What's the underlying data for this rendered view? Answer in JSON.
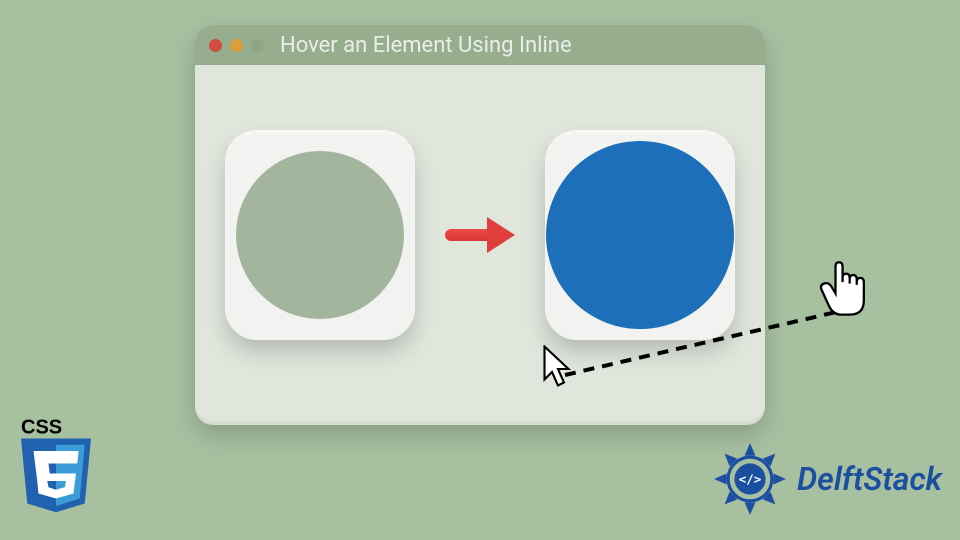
{
  "window": {
    "title": "Hover an Element Using Inline"
  },
  "colors": {
    "page_bg": "#a7c0a0",
    "titlebar_bg": "#96ad8e",
    "window_bg": "#e0e6dc",
    "card_bg": "#f2f3f0",
    "circle_default": "#a3b59c",
    "circle_hover": "#1c6fb8",
    "arrow": "#e03e3b",
    "brand_blue": "#1c4fa0"
  },
  "badges": {
    "css3_label": "CSS",
    "brand": "DelftStack"
  },
  "diagram": {
    "left_state": "default (not hovered)",
    "right_state": "hovered",
    "arrow_meaning": "transition on hover"
  }
}
